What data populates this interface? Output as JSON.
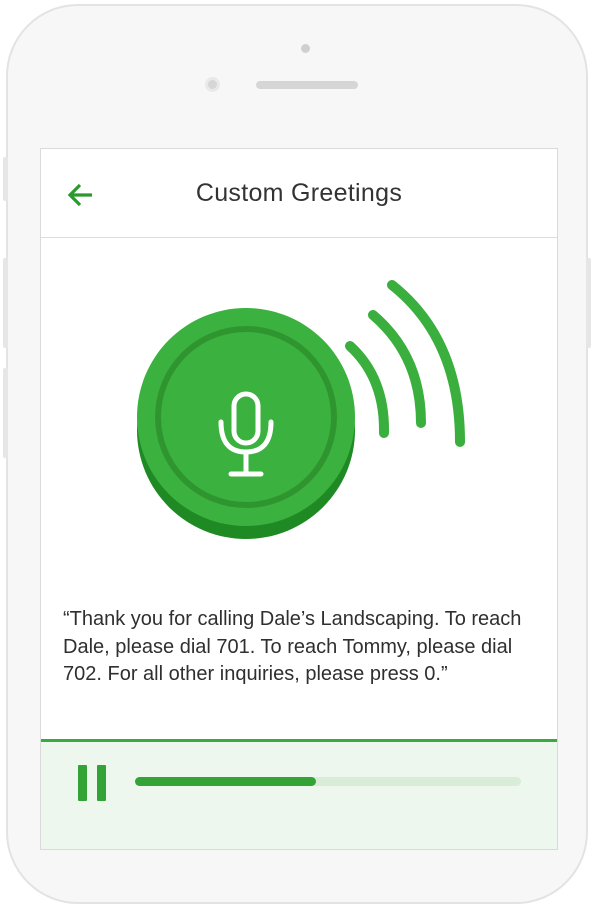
{
  "header": {
    "title": "Custom Greetings",
    "back_icon": "arrow-left-icon"
  },
  "illustration": {
    "icon": "microphone-icon",
    "waves_icon": "sound-waves-icon"
  },
  "greeting": {
    "text": "“Thank you for calling Dale’s Landscaping. To reach Dale, please dial 701. To reach Tommy, please dial 702. For all other inquiries, please press 0.”"
  },
  "player": {
    "control_icon": "pause-icon",
    "progress": 0.47
  },
  "colors": {
    "accent": "#33a336",
    "accent_dark": "#2a8a2d",
    "player_bg": "#eef7ee",
    "track": "#d8ecd8",
    "text": "#2f2f2f"
  }
}
